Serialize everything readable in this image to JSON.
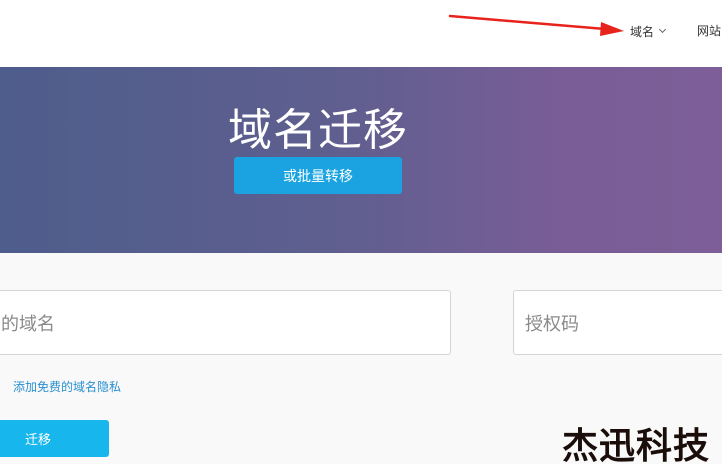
{
  "nav": {
    "domain_label": "域名",
    "website_label": "网站"
  },
  "hero": {
    "title": "域名迁移",
    "bulk_button_label": "或批量转移"
  },
  "form": {
    "domain_placeholder": "的域名",
    "auth_placeholder": "授权码",
    "privacy_link": "添加免费的域名隐私",
    "migrate_button_label": "迁移"
  },
  "watermark": {
    "text": "杰迅科技"
  },
  "colors": {
    "annotation_arrow": "#e8231c",
    "hero_gradient_start": "#4e5d8c",
    "hero_gradient_end": "#7d5e98",
    "bulk_button": "#1aa3e0",
    "migrate_button": "#17b7ee",
    "link": "#2a8fd0"
  },
  "icons": {
    "nav_dropdown": "chevron-down-icon",
    "annotation": "red-arrow-annotation"
  }
}
